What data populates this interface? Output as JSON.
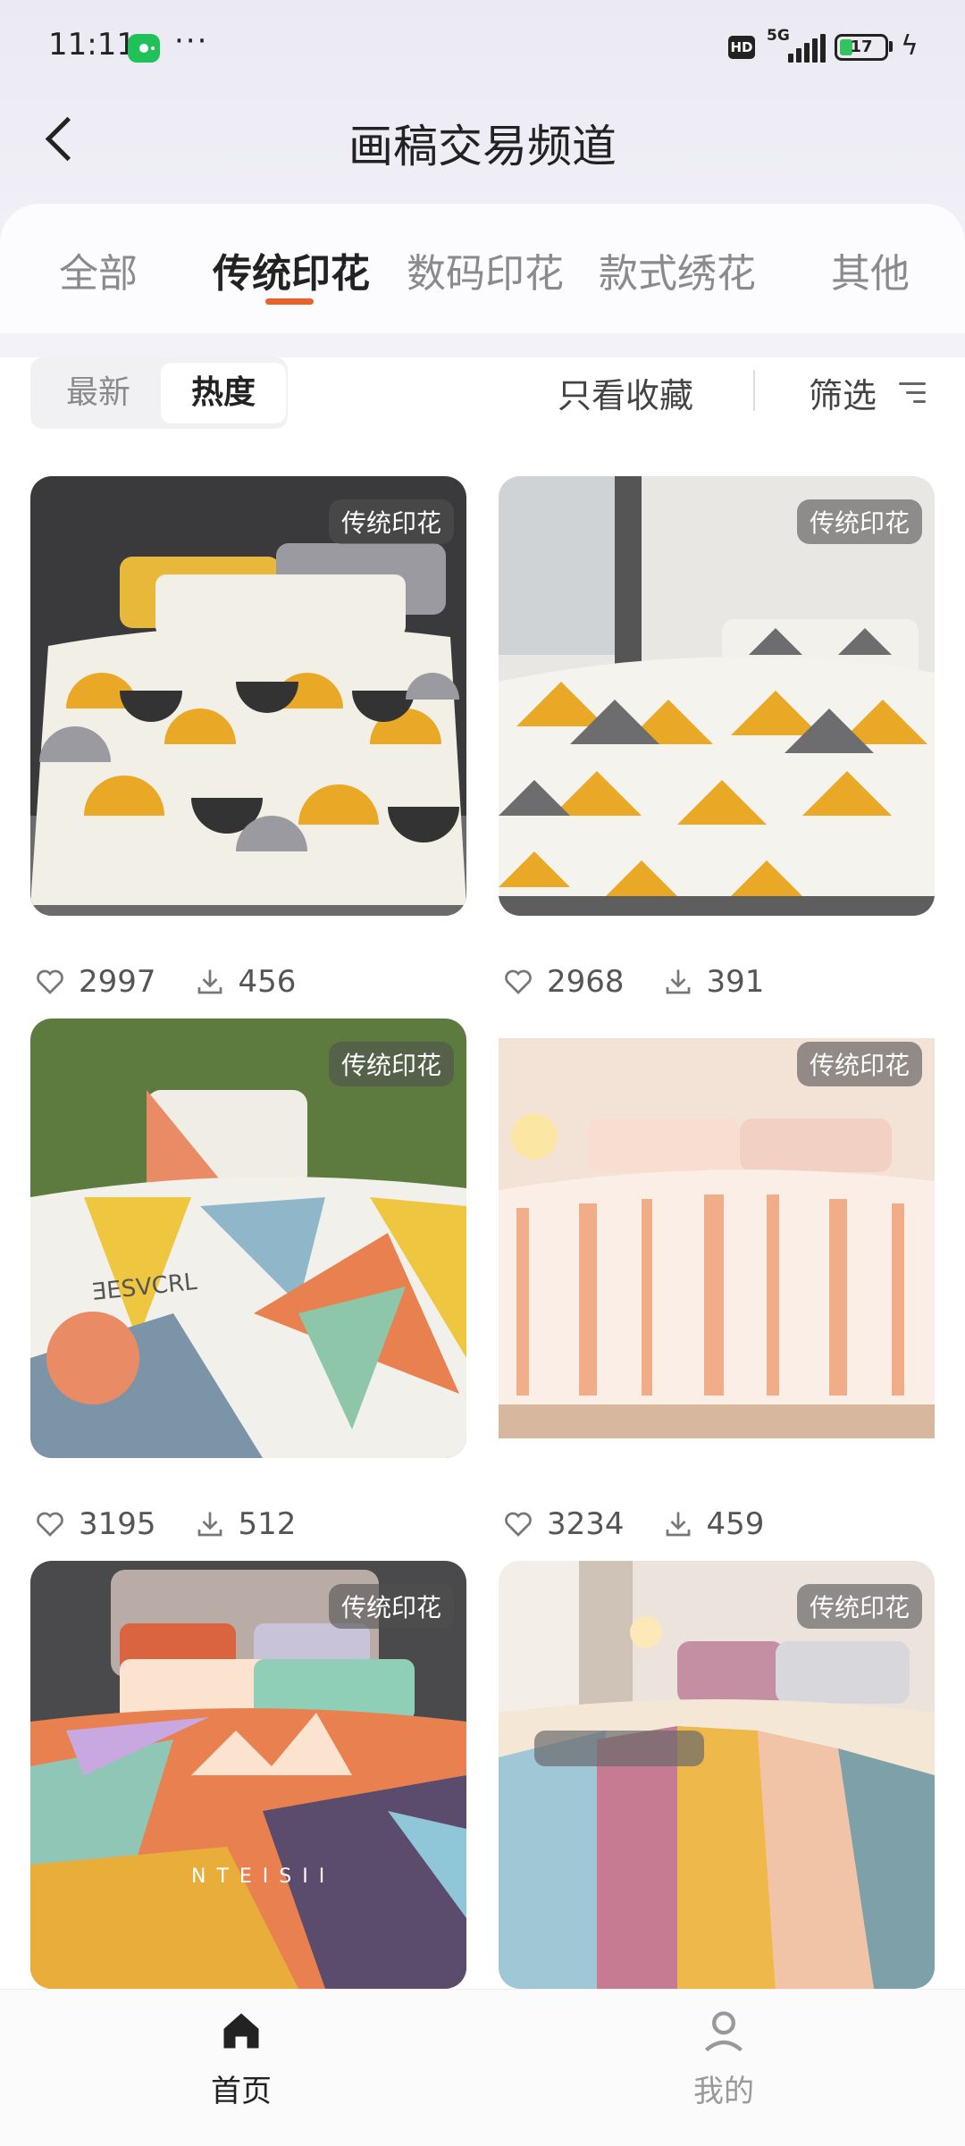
{
  "status_bar": {
    "time": "11:11",
    "more": "···",
    "hd": "HD",
    "network": "5G",
    "battery": "17"
  },
  "header": {
    "title": "画稿交易频道"
  },
  "tabs": [
    {
      "label": "全部"
    },
    {
      "label": "传统印花"
    },
    {
      "label": "数码印花"
    },
    {
      "label": "款式绣花"
    },
    {
      "label": "其他"
    }
  ],
  "filters": {
    "sort_options": [
      "最新",
      "热度"
    ],
    "favorites_only": "只看收藏",
    "filter_label": "筛选"
  },
  "cards": [
    {
      "tag": "传统印花",
      "likes": "2997",
      "downloads": "456"
    },
    {
      "tag": "传统印花",
      "likes": "2968",
      "downloads": "391"
    },
    {
      "tag": "传统印花",
      "likes": "3195",
      "downloads": "512"
    },
    {
      "tag": "传统印花",
      "likes": "3234",
      "downloads": "459"
    },
    {
      "tag": "传统印花",
      "likes": "",
      "downloads": ""
    },
    {
      "tag": "传统印花",
      "likes": "",
      "downloads": ""
    }
  ],
  "bottom_nav": [
    {
      "label": "首页",
      "icon": "home-icon"
    },
    {
      "label": "我的",
      "icon": "profile-icon"
    }
  ],
  "colors": {
    "accent": "#e8622b",
    "wechat": "#21c15a",
    "battery": "#35c35d"
  }
}
